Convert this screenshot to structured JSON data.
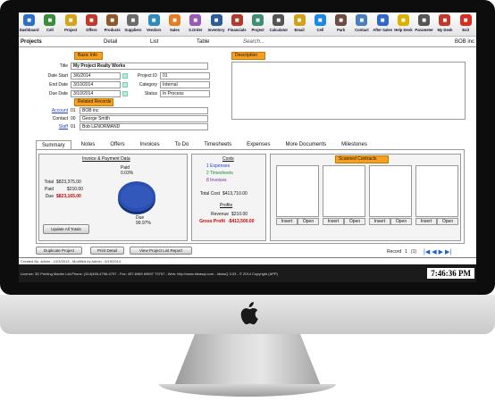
{
  "toolbar": {
    "items": [
      {
        "label": "Dashboard",
        "icon": "dashboard-icon",
        "color": "#2a6fc9"
      },
      {
        "label": "Cell",
        "icon": "phone-icon",
        "color": "#3a8d3a"
      },
      {
        "label": "Project",
        "icon": "project-icon",
        "color": "#d9a21c"
      },
      {
        "label": "Offers",
        "icon": "offers-icon",
        "color": "#c0392b"
      },
      {
        "label": "Products",
        "icon": "products-icon",
        "color": "#8e5a2a"
      },
      {
        "label": "Suppliers",
        "icon": "suppliers-icon",
        "color": "#6b6b6b"
      },
      {
        "label": "Vendors",
        "icon": "vendors-icon",
        "color": "#2d8bbd"
      },
      {
        "label": "Sales",
        "icon": "sales-icon",
        "color": "#e57c1e"
      },
      {
        "label": "S.Order",
        "icon": "order-icon",
        "color": "#9b59b6"
      },
      {
        "label": "Inventory",
        "icon": "inventory-icon",
        "color": "#2b5d9c"
      },
      {
        "label": "Financials",
        "icon": "financials-icon",
        "color": "#b03a2e"
      },
      {
        "label": "Project",
        "icon": "project-icon",
        "color": "#3c8f70"
      },
      {
        "label": "Calculator",
        "icon": "calculator-icon",
        "color": "#555555"
      },
      {
        "label": "Email",
        "icon": "email-icon",
        "color": "#d4a017"
      },
      {
        "label": "Cell",
        "icon": "phone-icon",
        "color": "#1e88e5"
      },
      {
        "label": "Park",
        "icon": "park-icon",
        "color": "#6d4c41"
      },
      {
        "label": "Contact",
        "icon": "contact-icon",
        "color": "#4a7fbf"
      },
      {
        "label": "After Sales",
        "icon": "tools-icon",
        "color": "#3366cc"
      },
      {
        "label": "Help Desk",
        "icon": "help-icon",
        "color": "#e0b000"
      },
      {
        "label": "Parameter",
        "icon": "gear-icon",
        "color": "#555555"
      },
      {
        "label": "My Desk",
        "icon": "desk-icon",
        "color": "#c0392b"
      },
      {
        "label": "Exit",
        "icon": "power-icon",
        "color": "#d62d20"
      }
    ]
  },
  "nav": {
    "module": "Projects",
    "links": [
      "Detail",
      "List",
      "Table"
    ],
    "search": "Search...",
    "company": "BOB inc"
  },
  "basic": {
    "header": "Basic Info",
    "title_label": "Title",
    "title_value": "My Project Realty Works",
    "date_start_label": "Date Start",
    "date_start": "3/6/2014",
    "end_date_label": "End Date",
    "end_date": "3/10/2014",
    "due_date_label": "Due Date",
    "due_date": "3/10/2014",
    "project_id_label": "Project ID",
    "project_id": "01",
    "category_label": "Category",
    "category": "Internal",
    "status_label": "Status",
    "status": "In Process"
  },
  "description": {
    "header": "Description"
  },
  "related": {
    "header": "Related Records",
    "account_label": "Account",
    "account_id": "01",
    "account_name": "BOB inc",
    "contact_label": "Contact",
    "contact_id": "00",
    "contact_name": "George Smith",
    "staff_label": "Staff",
    "staff_id": "01",
    "staff_name": "Bob LENORMAND"
  },
  "tabs": [
    "Summary",
    "Notes",
    "Offers",
    "Invoices",
    "To Do",
    "Timesheets",
    "Expenses",
    "More Documents",
    "Milestones"
  ],
  "invoice": {
    "header": "Invoice & Payment Data",
    "total_label": "Total",
    "total": "$823,375.00",
    "paid_label": "Paid",
    "paid": "$210.00",
    "due_label": "Due",
    "due": "$823,165.00",
    "pie_paid_label": "Paid",
    "pie_paid_pct": "0.03%",
    "pie_due_label": "Due",
    "pie_due_pct": "99.97%",
    "update_btn": "Update All Totals"
  },
  "costs": {
    "header": "Costs",
    "expenses": "1 Expenses",
    "timesheets": "2 Timesheets",
    "invoices": "8 Invoices",
    "total_cost_label": "Total Cost",
    "total_cost": "$413,710.00",
    "profits_header": "Profits",
    "revenue_label": "Revenue",
    "revenue": "$210.00",
    "gross_profit_label": "Gross Profit",
    "gross_profit": "-$413,500.00"
  },
  "scanned": {
    "header": "Scanned Contracts",
    "insert_label": "Insert",
    "open_label": "Open"
  },
  "buttons": {
    "duplicate": "Duplicate Project",
    "print": "Print Detail",
    "view_report": "View Project List Report"
  },
  "record": {
    "label": "Record",
    "current": "1",
    "total": "(1)"
  },
  "footer": {
    "created": "Created By: admin - 10/3/2013 - Modified by Admin - 6/19/2014",
    "license": "License: 3D Printing Madrin Ltd-Phone: (314)465-4796-4797 - Fax: 457-6969 69697 79797 - Web: http://www.ideasql.com - IdeasQ 3.03 - © 2014 Copyright (APP)",
    "clock": "7:46:36 PM"
  }
}
